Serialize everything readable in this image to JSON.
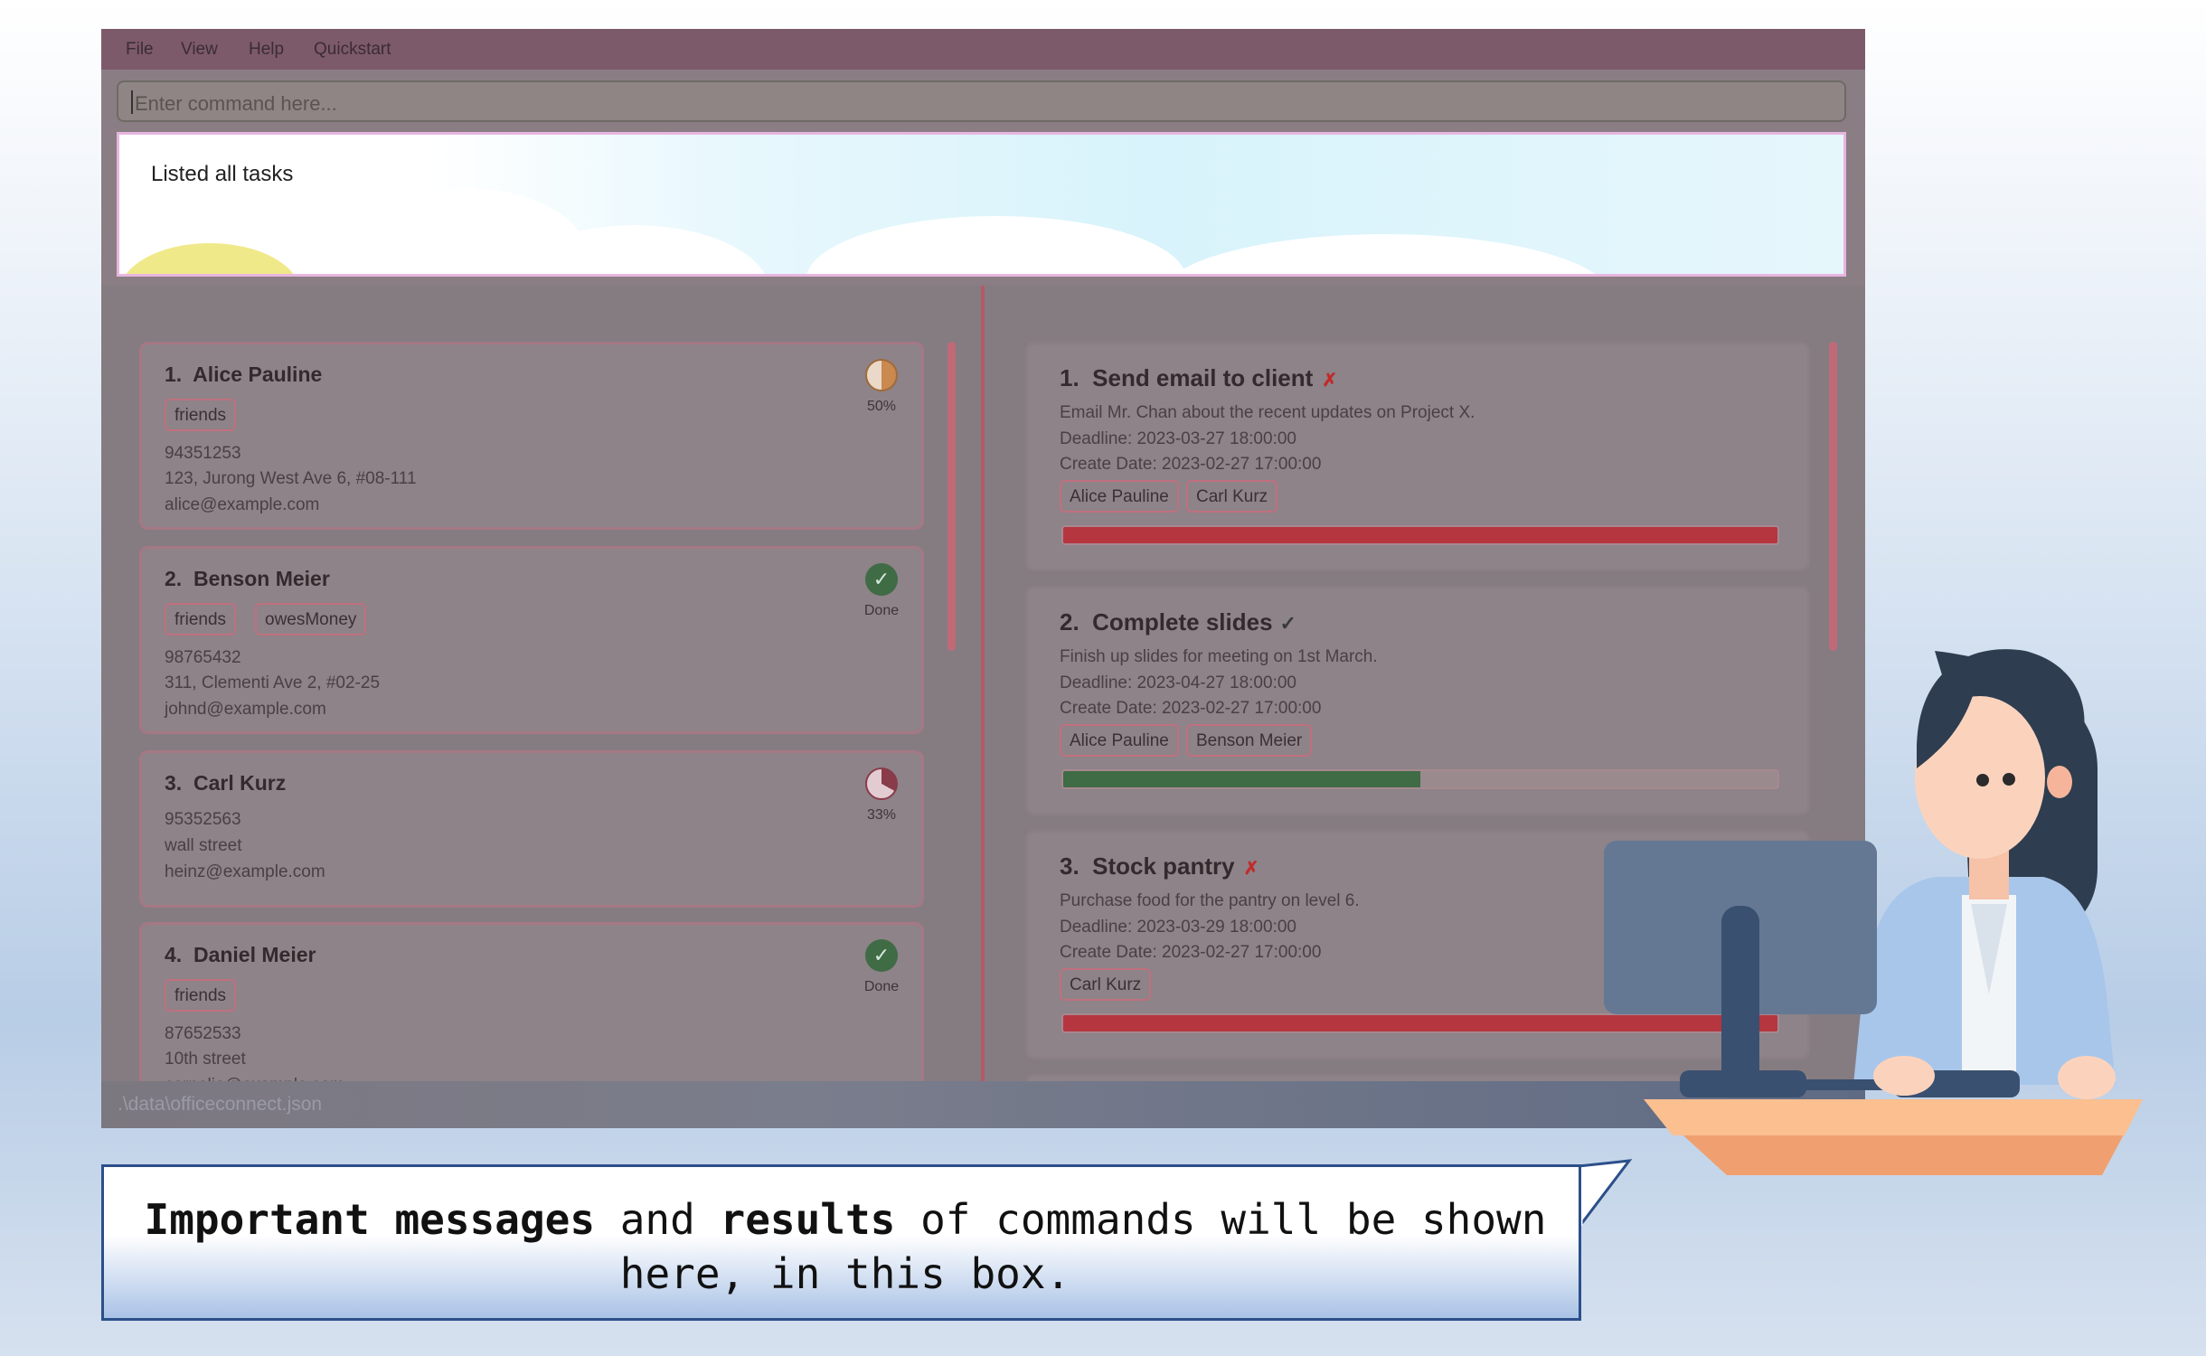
{
  "menu": [
    "File",
    "View",
    "Help",
    "Quickstart"
  ],
  "command_box": {
    "placeholder": "Enter command here..."
  },
  "result_display": {
    "text": "Listed all tasks"
  },
  "persons": [
    {
      "index": "1.",
      "name": "Alice Pauline",
      "tags": [
        "friends"
      ],
      "phone": "94351253",
      "address": "123, Jurong West Ave 6, #08-111",
      "email": "alice@example.com",
      "status": "50%"
    },
    {
      "index": "2.",
      "name": "Benson Meier",
      "tags": [
        "friends",
        "owesMoney"
      ],
      "phone": "98765432",
      "address": "311, Clementi Ave 2, #02-25",
      "email": "johnd@example.com",
      "status": "Done"
    },
    {
      "index": "3.",
      "name": "Carl Kurz",
      "tags": [],
      "phone": "95352563",
      "address": "wall street",
      "email": "heinz@example.com",
      "status": "33%"
    },
    {
      "index": "4.",
      "name": "Daniel Meier",
      "tags": [
        "friends"
      ],
      "phone": "87652533",
      "address": "10th street",
      "email": "cornelia@example.com",
      "status": "Done"
    }
  ],
  "tasks": [
    {
      "index": "1.",
      "title": "Send email to client",
      "mark": "✗",
      "description": "Email Mr. Chan about the recent updates on Project X.",
      "deadline": "Deadline: 2023-03-27 18:00:00",
      "created": "Create Date: 2023-02-27 17:00:00",
      "assignees": [
        "Alice Pauline",
        "Carl Kurz"
      ],
      "progress": 1.0,
      "progress_color": "#b5363f"
    },
    {
      "index": "2.",
      "title": "Complete slides",
      "mark": "✓",
      "description": "Finish up slides for meeting on 1st March.",
      "deadline": "Deadline: 2023-04-27 18:00:00",
      "created": "Create Date: 2023-02-27 17:00:00",
      "assignees": [
        "Alice Pauline",
        "Benson Meier"
      ],
      "progress": 0.5,
      "progress_color": "#3f6b45"
    },
    {
      "index": "3.",
      "title": "Stock pantry",
      "mark": "✗",
      "description": "Purchase food for the pantry on level 6.",
      "deadline": "Deadline: 2023-03-29 18:00:00",
      "created": "Create Date: 2023-02-27 17:00:00",
      "assignees": [
        "Carl Kurz"
      ],
      "progress": 1.0,
      "progress_color": "#b5363f"
    }
  ],
  "statusbar": {
    "path": ".\\data\\officeconnect.json"
  },
  "callout": {
    "b1": "Important messages",
    "t1": " and ",
    "b2": "results",
    "t2": " of commands will be shown here, in this box."
  },
  "colors": {
    "accent": "#b35a6a",
    "done": "#3f6b45",
    "overdue": "#b5363f"
  }
}
